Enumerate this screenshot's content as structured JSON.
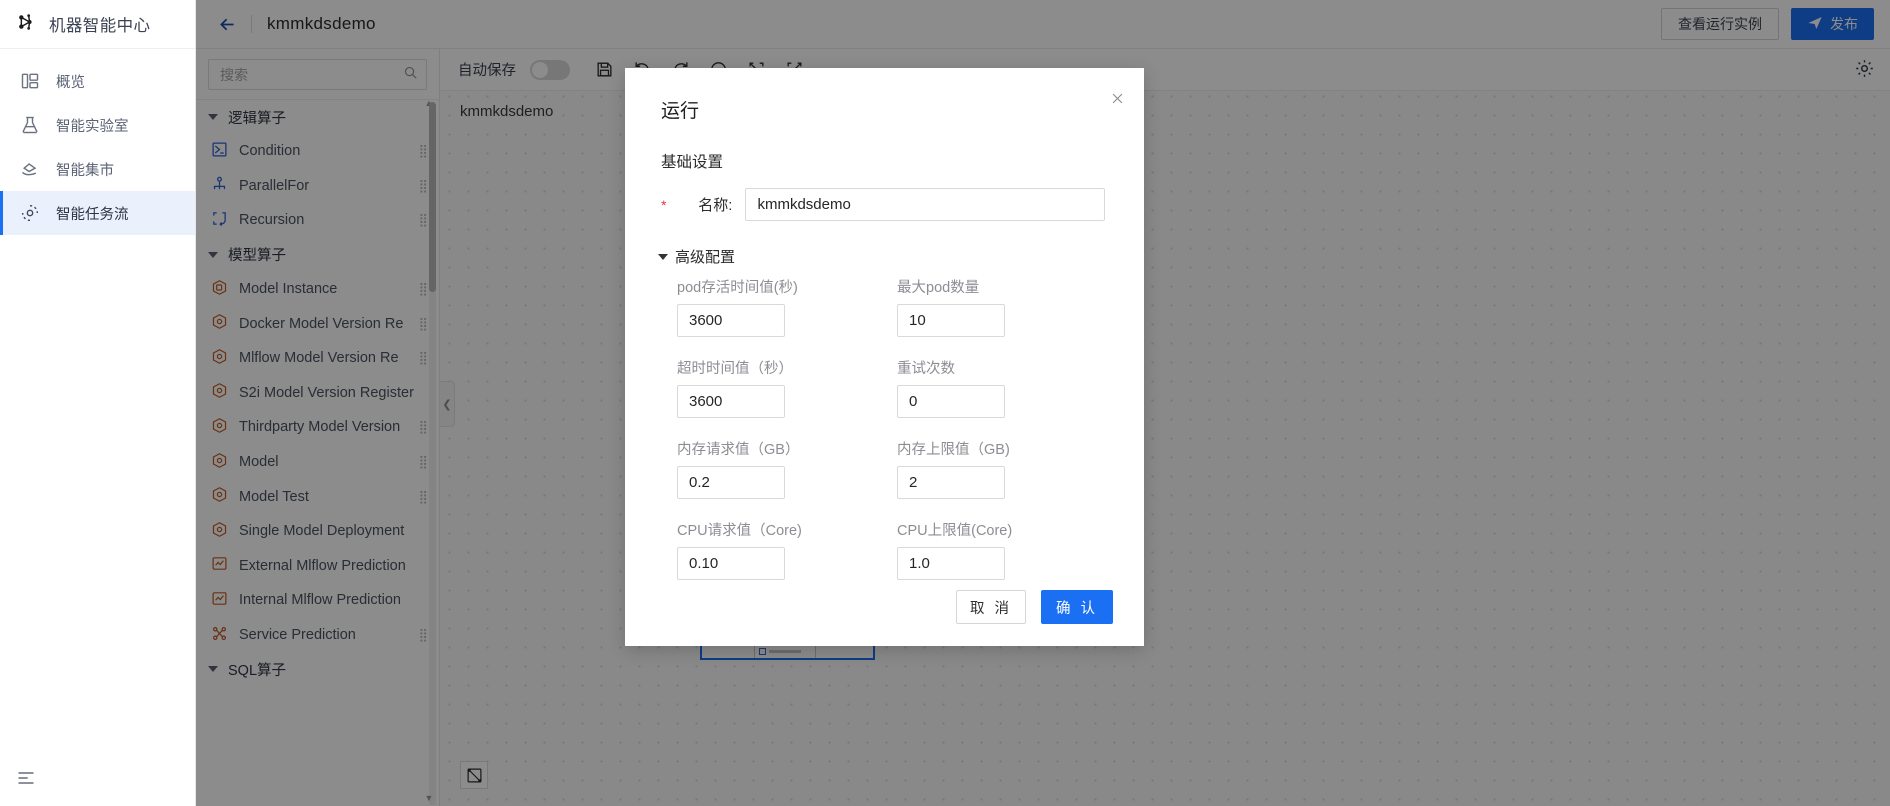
{
  "sidebar": {
    "brand": "机器智能中心",
    "brand_icon": "brain-network-icon",
    "items": [
      {
        "label": "概览",
        "icon": "dashboard-icon",
        "active": false
      },
      {
        "label": "智能实验室",
        "icon": "flask-icon",
        "active": false
      },
      {
        "label": "智能集市",
        "icon": "marketplace-icon",
        "active": false
      },
      {
        "label": "智能任务流",
        "icon": "workflow-target-icon",
        "active": true
      }
    ],
    "collapse_icon": "menu-collapse-icon"
  },
  "topbar": {
    "back_icon": "back-arrow-icon",
    "project_title": "kmmkdsdemo",
    "view_instances_label": "查看运行实例",
    "publish_label": "发布",
    "publish_icon": "send-icon"
  },
  "operator_panel": {
    "search_placeholder": "搜索",
    "search_value": "",
    "search_icon": "search-icon",
    "groups": [
      {
        "title": "逻辑算子",
        "items": [
          {
            "label": "Condition",
            "icon": "condition-icon",
            "color": "#2f5fd0"
          },
          {
            "label": "ParallelFor",
            "icon": "parallel-for-icon",
            "color": "#2f5fd0"
          },
          {
            "label": "Recursion",
            "icon": "recursion-icon",
            "color": "#2f5fd0"
          }
        ]
      },
      {
        "title": "模型算子",
        "items": [
          {
            "label": "Model Instance",
            "icon": "model-instance-icon",
            "color": "#c05a22"
          },
          {
            "label": "Docker Model Version Re",
            "icon": "model-version-icon",
            "color": "#c05a22"
          },
          {
            "label": "Mlflow Model Version Re",
            "icon": "model-version-icon",
            "color": "#c05a22"
          },
          {
            "label": "S2i Model Version Register",
            "icon": "model-version-icon",
            "color": "#c05a22"
          },
          {
            "label": "Thirdparty Model Version",
            "icon": "model-version-icon",
            "color": "#c05a22"
          },
          {
            "label": "Model",
            "icon": "model-icon",
            "color": "#c05a22"
          },
          {
            "label": "Model Test",
            "icon": "model-test-icon",
            "color": "#c05a22"
          },
          {
            "label": "Single Model Deployment",
            "icon": "deployment-icon",
            "color": "#c05a22"
          },
          {
            "label": "External Mlflow Prediction",
            "icon": "prediction-icon",
            "color": "#c05a22"
          },
          {
            "label": "Internal Mlflow Prediction",
            "icon": "prediction-icon",
            "color": "#c05a22"
          },
          {
            "label": "Service Prediction",
            "icon": "service-prediction-icon",
            "color": "#c05a22"
          }
        ]
      },
      {
        "title": "SQL算子",
        "items": []
      }
    ],
    "drag_handle_icon": "drag-grip-icon"
  },
  "canvas": {
    "autosave_label": "自动保存",
    "autosave_on": false,
    "flow_name": "kmmkdsdemo",
    "toolbar_icons": [
      "save-icon",
      "undo-icon",
      "redo-icon",
      "revert-icon",
      "import-icon",
      "export-icon"
    ],
    "settings_icon": "gear-icon",
    "fit-view_icon": "fit-view-icon",
    "collapse_panel_icon": "chevron-left-icon"
  },
  "modal": {
    "title": "运行",
    "close_icon": "close-icon",
    "section_title": "基础设置",
    "name_field": {
      "required_mark": "*",
      "label": "名称:",
      "value": "kmmkdsdemo"
    },
    "advanced": {
      "toggle_label": "高级配置",
      "expanded": true,
      "fields": [
        {
          "label": "pod存活时间值(秒)",
          "value": "3600"
        },
        {
          "label": "最大pod数量",
          "value": "10"
        },
        {
          "label": "超时时间值（秒）",
          "value": "3600"
        },
        {
          "label": "重试次数",
          "value": "0"
        },
        {
          "label": "内存请求值（GB）",
          "value": "0.2"
        },
        {
          "label": "内存上限值（GB)",
          "value": "2"
        },
        {
          "label": "CPU请求值（Core)",
          "value": "0.10"
        },
        {
          "label": "CPU上限值(Core)",
          "value": "1.0"
        }
      ]
    },
    "cancel_label": "取 消",
    "confirm_label": "确 认"
  },
  "colors": {
    "accent": "#1b6ff3",
    "active_nav_bg": "#eaf1fd",
    "required_red": "#e23b3b",
    "overlay": "rgba(0,0,0,0.45)"
  }
}
